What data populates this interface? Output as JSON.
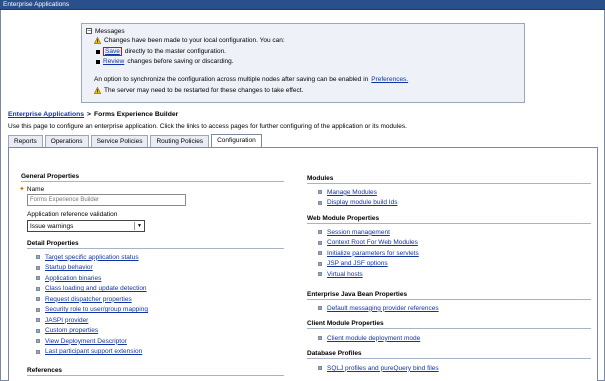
{
  "window": {
    "title": "Enterprise Applications"
  },
  "messages": {
    "header": "Messages",
    "changes_notice": "Changes have been made to your local configuration. You can:",
    "save_link": "Save",
    "save_text": "directly to the master configuration.",
    "review_link": "Review",
    "review_text": "changes before saving or discarding.",
    "sync_text": "An option to synchronize the configuration across multiple nodes after saving can be enabled in",
    "preferences_link": "Preferences.",
    "restart_notice": "The server may need to be restarted for these changes to take effect."
  },
  "breadcrumb": {
    "parent": "Enterprise Applications",
    "separator": ">",
    "current": "Forms Experience Builder"
  },
  "page_description": "Use this page to configure an enterprise application. Click the links to access pages for further configuring of the application or its modules.",
  "tabs": [
    {
      "label": "Reports"
    },
    {
      "label": "Operations"
    },
    {
      "label": "Service Policies"
    },
    {
      "label": "Routing Policies"
    },
    {
      "label": "Configuration"
    }
  ],
  "general_properties": {
    "title": "General Properties",
    "name_label": "Name",
    "name_value": "Forms Experience Builder",
    "validation_label": "Application reference validation",
    "validation_value": "Issue warnings"
  },
  "detail_properties": {
    "title": "Detail Properties",
    "items": [
      "Target specific application status",
      "Startup behavior",
      "Application binaries",
      "Class loading and update detection",
      "Request dispatcher properties",
      "Security role to user/group mapping",
      "JASPI provider",
      "Custom properties",
      "View Deployment Descriptor",
      "Last participant support extension"
    ]
  },
  "references": {
    "title": "References"
  },
  "modules": {
    "title": "Modules",
    "items": [
      "Manage Modules",
      "Display module build Ids"
    ]
  },
  "web_module_properties": {
    "title": "Web Module Properties",
    "items": [
      "Session management",
      "Context Root For Web Modules",
      "Initialize parameters for servlets",
      "JSP and JSF options",
      "Virtual hosts"
    ]
  },
  "ejb_properties": {
    "title": "Enterprise Java Bean Properties",
    "items": [
      "Default messaging provider references"
    ]
  },
  "client_module_properties": {
    "title": "Client Module Properties",
    "items": [
      "Client module deployment mode"
    ]
  },
  "database_profiles": {
    "title": "Database Profiles",
    "items": [
      "SQLJ profiles and pureQuery bind files"
    ]
  },
  "colors": {
    "title_bar": "#29508b",
    "link": "#1034a6",
    "message_bg": "#eef2f8",
    "tab_bg": "#e9edf3",
    "highlight_border": "#d01010"
  }
}
